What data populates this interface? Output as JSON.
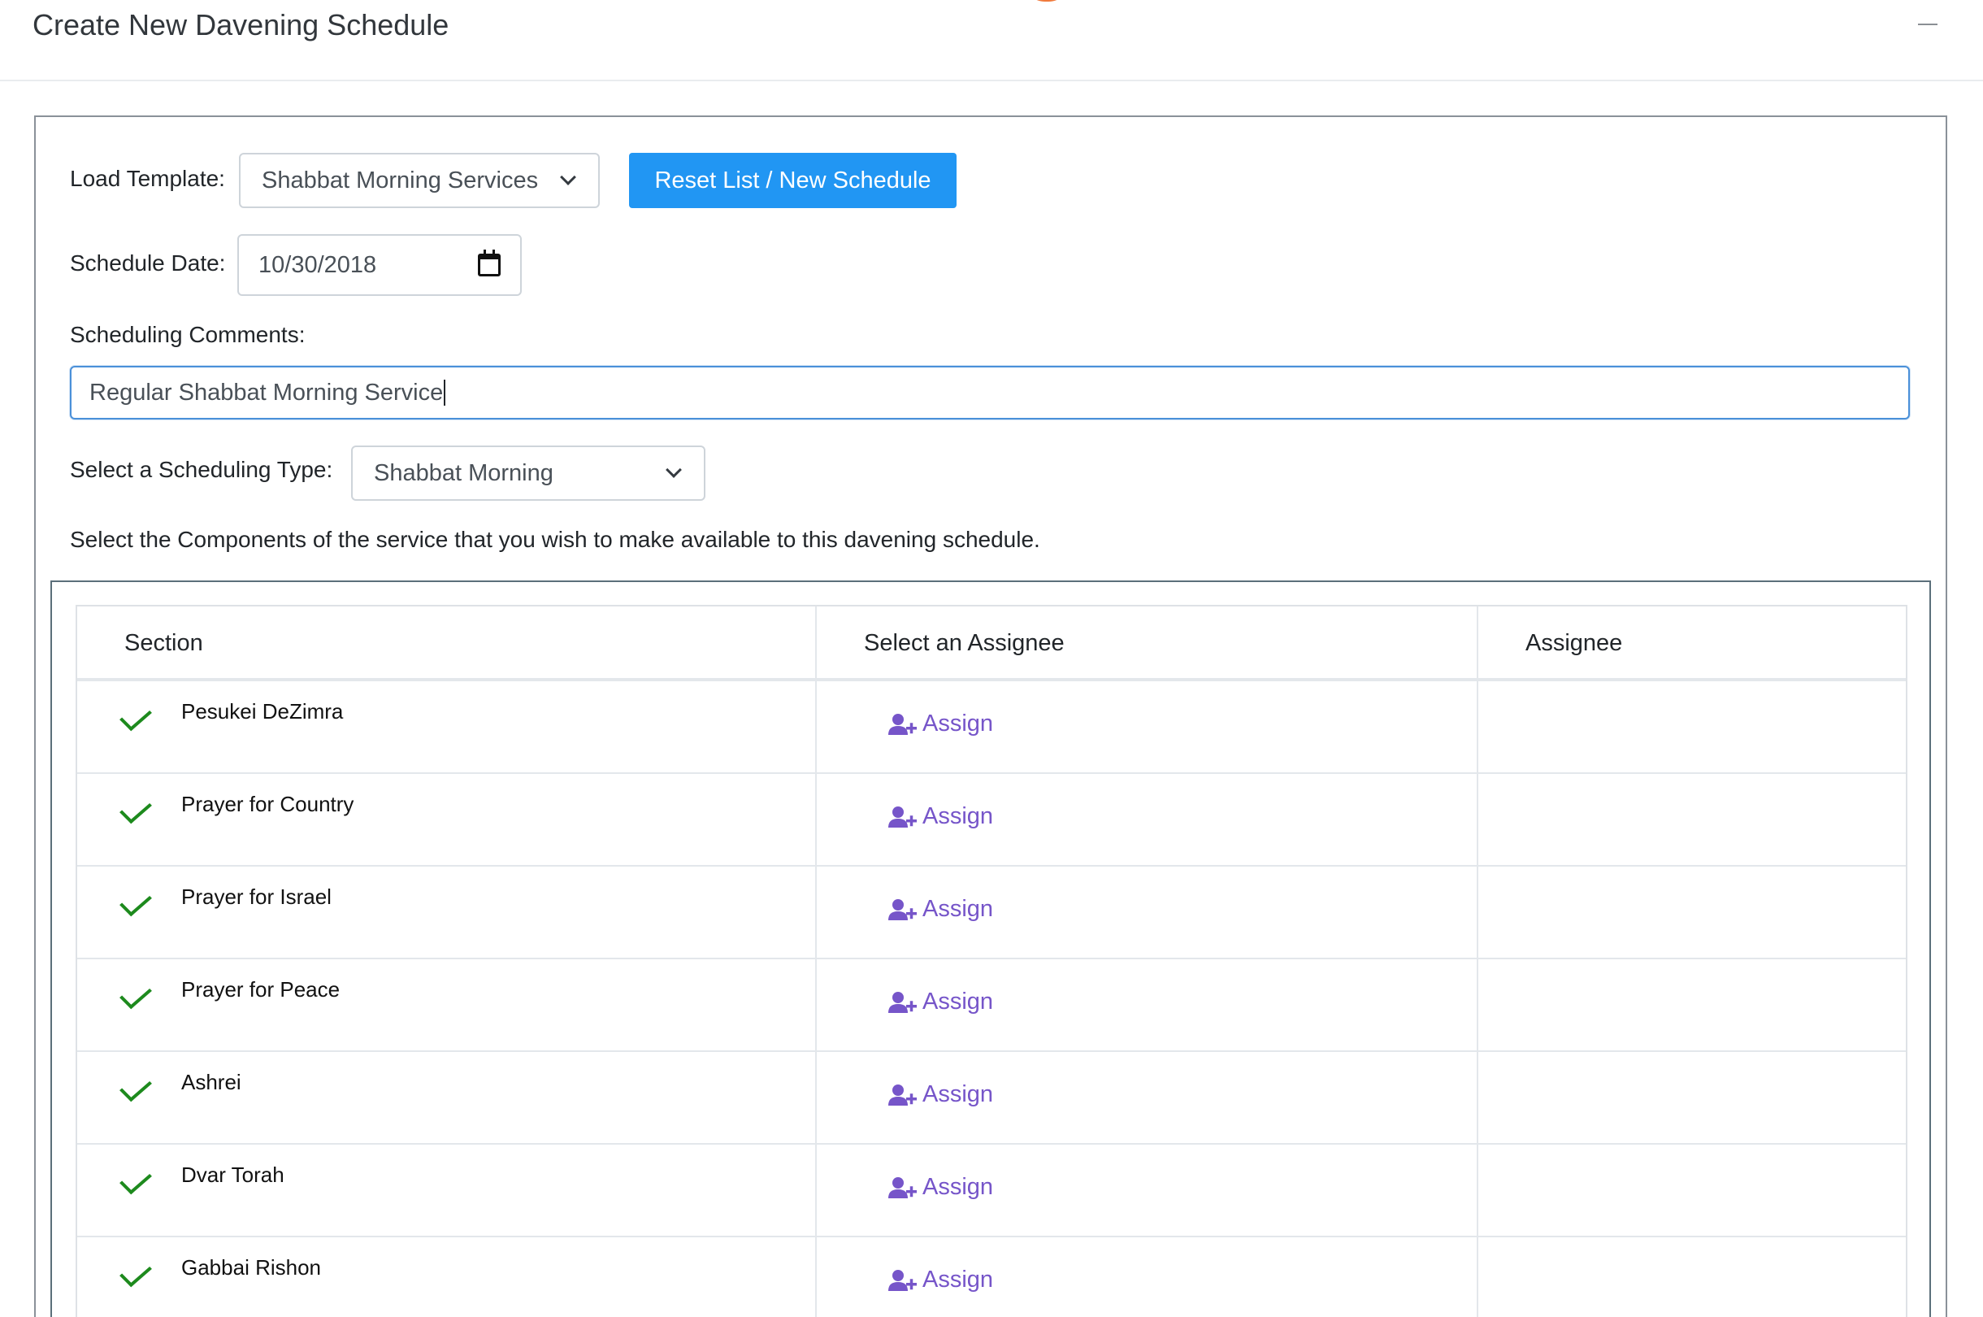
{
  "header": {
    "title": "Create New Davening Schedule"
  },
  "form": {
    "load_template_label": "Load Template:",
    "template_selected": "Shabbat Morning Services",
    "reset_button_label": "Reset List / New Schedule",
    "schedule_date_label": "Schedule Date:",
    "schedule_date_value": "10/30/2018",
    "comments_label": "Scheduling Comments:",
    "comments_value": "Regular Shabbat Morning Service",
    "scheduling_type_label": "Select a Scheduling Type:",
    "scheduling_type_selected": "Shabbat Morning",
    "instructions": "Select the Components of the service that you wish to make available to this davening schedule."
  },
  "table": {
    "columns": [
      "Section",
      "Select an Assignee",
      "Assignee"
    ],
    "rows": [
      {
        "section": "Pesukei DeZimra",
        "selected": true,
        "action": "Assign",
        "assignee": ""
      },
      {
        "section": "Prayer for Country",
        "selected": true,
        "action": "Assign",
        "assignee": ""
      },
      {
        "section": "Prayer for Israel",
        "selected": true,
        "action": "Assign",
        "assignee": ""
      },
      {
        "section": "Prayer for Peace",
        "selected": true,
        "action": "Assign",
        "assignee": ""
      },
      {
        "section": "Ashrei",
        "selected": true,
        "action": "Assign",
        "assignee": ""
      },
      {
        "section": "Dvar Torah",
        "selected": true,
        "action": "Assign",
        "assignee": ""
      },
      {
        "section": "Gabbai Rishon",
        "selected": true,
        "action": "Assign",
        "assignee": ""
      }
    ]
  },
  "colors": {
    "primary_button": "#2196f3",
    "check_green": "#1d8a1d",
    "assign_purple": "#7655c9",
    "focus_border": "#4a90d9"
  },
  "icons": {
    "minimize": "minimize-icon",
    "calendar": "calendar-icon",
    "select_chevron": "chevron-down-icon",
    "checkmark": "check-icon",
    "assign": "user-plus-icon"
  }
}
